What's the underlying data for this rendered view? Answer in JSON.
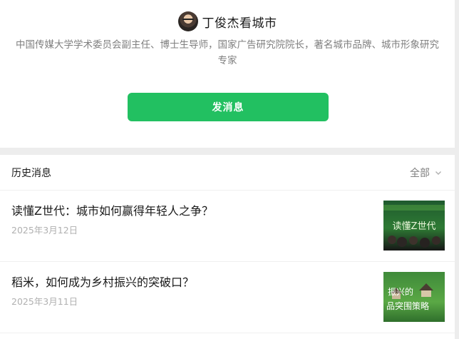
{
  "profile": {
    "name": "丁俊杰看城市",
    "bio": "中国传媒大学学术委员会副主任、博士生导师，国家广告研究院院长，著名城市品牌、城市形象研究专家",
    "send_button": "发消息"
  },
  "history": {
    "title": "历史消息",
    "filter_label": "全部",
    "articles": [
      {
        "title": "读懂Z世代：城市如何赢得年轻人之争？",
        "date": "2025年3月12日",
        "thumb_text": "读懂Z世代"
      },
      {
        "title": "稻米，如何成为乡村振兴的突破口？",
        "date": "2025年3月11日",
        "thumb_text": "振兴的品突围策略"
      }
    ]
  },
  "colors": {
    "accent": "#22c061",
    "secondary_text": "#7f7f7f",
    "date_text": "#b0b0b0"
  },
  "icons": {
    "filter": "chevron-down-icon"
  }
}
